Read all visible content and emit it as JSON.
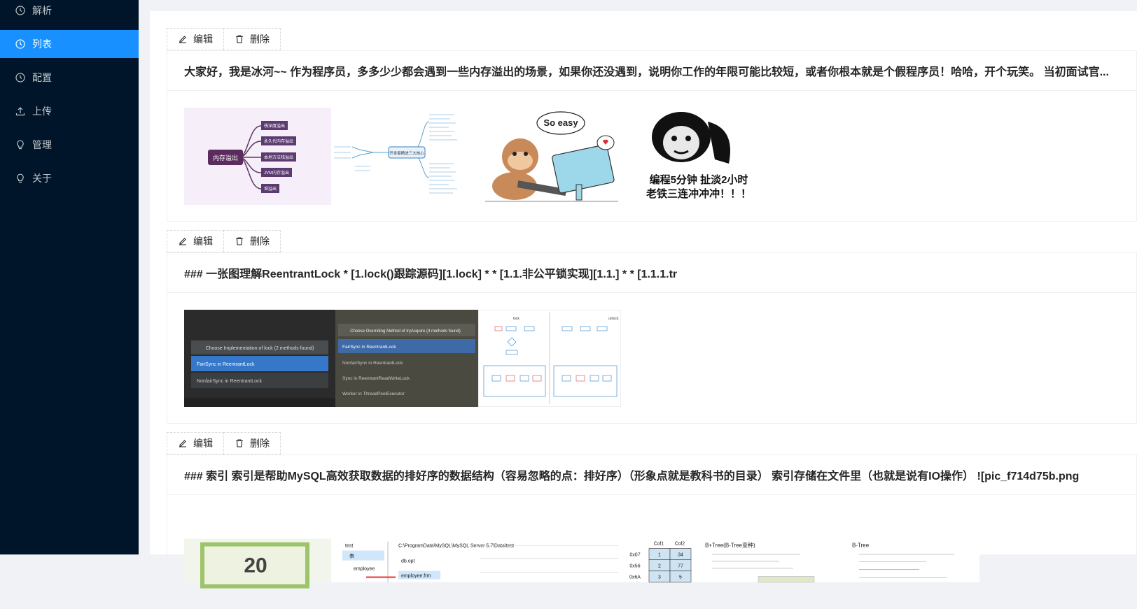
{
  "sidebar": {
    "items": [
      {
        "label": "解析",
        "icon": "clock-circle-icon"
      },
      {
        "label": "列表",
        "icon": "clock-circle-icon",
        "active": true
      },
      {
        "label": "配置",
        "icon": "clock-circle-icon"
      },
      {
        "label": "上传",
        "icon": "upload-icon"
      },
      {
        "label": "管理",
        "icon": "bulb-icon"
      },
      {
        "label": "关于",
        "icon": "bulb-icon"
      }
    ]
  },
  "actions": {
    "edit_label": "编辑",
    "delete_label": "删除"
  },
  "posts": [
    {
      "title": "大家好，我是冰河~~ 作为程序员，多多少少都会遇到一些内存溢出的场景，如果你还没遇到，说明你工作的年限可能比较短，或者你根本就是个假程序员！哈哈，开个玩笑。 当初面试官...",
      "images": [
        {
          "desc": "mindmap-memory-overflow",
          "texts": [
            "内存溢出",
            "栈深度溢出",
            "永久代内存溢出",
            "本地方法栈溢出",
            "JVM内存溢出",
            "堆溢出"
          ]
        },
        {
          "desc": "mindmap-developer-skills",
          "texts": [
            "开发者精进三大核心"
          ]
        },
        {
          "desc": "cartoon-monkey-programmer",
          "texts": [
            "So easy"
          ]
        },
        {
          "desc": "panda-meme",
          "texts": [
            "编程5分钟 扯淡2小时",
            "老铁三连冲冲冲！！！"
          ]
        }
      ]
    },
    {
      "title": "### 一张图理解ReentrantLock * [1.lock()跟踪源码][1.lock] * * [1.1.非公平锁实现][1.1.] * * [1.1.1.tr",
      "images": [
        {
          "desc": "ide-screenshot-lock-implementations",
          "texts": [
            "Choose Implementation of lock (2 methods found)",
            "FairSync in ReentrantLock",
            "NonfairSync in ReentrantLock"
          ]
        },
        {
          "desc": "ide-screenshot-tryacquire",
          "texts": [
            "Choose Overriding Method of tryAcquire (4 methods found)",
            "FairSync in ReentrantLock",
            "NonfairSync in ReentrantLock",
            "Sync in ReentrantReadWriteLock",
            "Worker in ThreadPoolExecutor"
          ]
        },
        {
          "desc": "flow-diagram-lock-unlock",
          "texts": [
            "lock",
            "unlock"
          ]
        }
      ]
    },
    {
      "title": "### 索引 索引是帮助MySQL高效获取数据的排好序的数据结构（容易忽略的点：排好序）（形象点就是教科书的目录） 索引存储在文件里（也就是说有IO操作） ![pic_f714d75b.png",
      "images": [
        {
          "desc": "table-cell-20",
          "texts": [
            "20"
          ]
        },
        {
          "desc": "mysql-data-folder",
          "texts": [
            "test",
            "表",
            "employee",
            "C:\\ProgramData\\MySQL\\MySQL Server 5.7\\Data\\test",
            "db.opt",
            "employee.frm"
          ]
        },
        {
          "desc": "hash-index-table",
          "texts": [
            "Col1",
            "Col2",
            "0x07",
            "0x56",
            "0x6A",
            "1",
            "34",
            "2",
            "77",
            "3",
            "5"
          ]
        },
        {
          "desc": "btree-notes",
          "texts": [
            "B+Tree(B-Tree变种)",
            "B-Tree"
          ]
        }
      ]
    }
  ]
}
